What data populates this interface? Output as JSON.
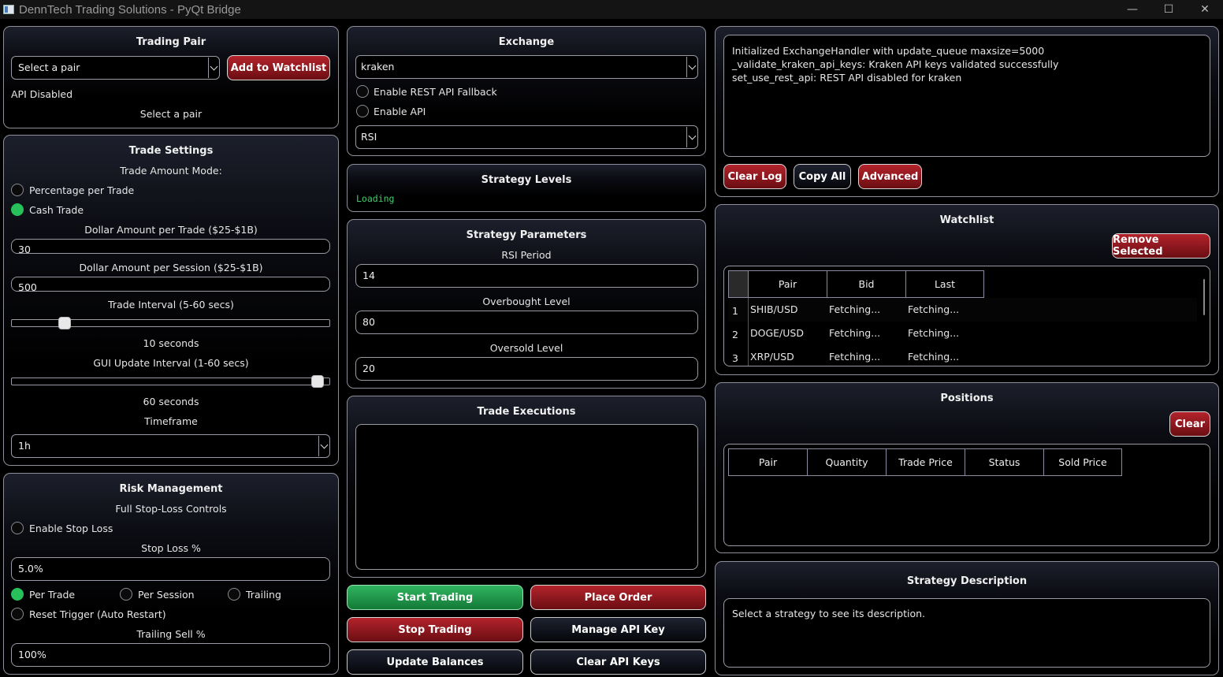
{
  "window": {
    "title": "DennTech Trading Solutions - PyQt Bridge",
    "minimize": "—",
    "maximize": "☐",
    "close": "✕"
  },
  "trading_pair": {
    "title": "Trading Pair",
    "select_value": "Select a pair",
    "add_button": "Add to Watchlist",
    "api_status": "API Disabled",
    "selected_label": "Select a pair"
  },
  "trade_settings": {
    "title": "Trade Settings",
    "mode_label": "Trade Amount Mode:",
    "mode_percentage": "Percentage per Trade",
    "mode_cash": "Cash Trade",
    "mode_selected": "Cash Trade",
    "dollar_trade_label": "Dollar Amount per Trade ($25-$1B)",
    "dollar_trade_value": "30",
    "dollar_session_label": "Dollar Amount per Session ($25-$1B)",
    "dollar_session_value": "500",
    "interval_label": "Trade Interval (5-60 secs)",
    "interval_value": 10,
    "interval_min": 5,
    "interval_max": 60,
    "interval_text": "10 seconds",
    "gui_label": "GUI Update Interval (1-60 secs)",
    "gui_value": 60,
    "gui_min": 1,
    "gui_max": 60,
    "gui_text": "60 seconds",
    "timeframe_label": "Timeframe",
    "timeframe_value": "1h"
  },
  "risk": {
    "title": "Risk Management",
    "subtitle": "Full Stop-Loss Controls",
    "enable_stop_loss": "Enable Stop Loss",
    "stop_loss_label": "Stop Loss %",
    "stop_loss_value": "5.0%",
    "per_trade": "Per Trade",
    "per_session": "Per Session",
    "trailing": "Trailing",
    "scope_selected": "Per Trade",
    "reset_trigger": "Reset Trigger (Auto Restart)",
    "trailing_sell_label": "Trailing Sell %",
    "trailing_sell_value": "100%"
  },
  "exchange": {
    "title": "Exchange",
    "select_value": "kraken",
    "rest_fallback": "Enable REST API Fallback",
    "enable_api": "Enable API",
    "strategy_value": "RSI"
  },
  "strategy_levels": {
    "title": "Strategy Levels",
    "status": "Loading"
  },
  "strategy_params": {
    "title": "Strategy Parameters",
    "rsi_label": "RSI Period",
    "rsi_value": "14",
    "overbought_label": "Overbought Level",
    "overbought_value": "80",
    "oversold_label": "Oversold Level",
    "oversold_value": "20"
  },
  "executions": {
    "title": "Trade Executions"
  },
  "actions": {
    "start": "Start Trading",
    "place_order": "Place Order",
    "stop": "Stop Trading",
    "manage_api": "Manage API Key",
    "update_balances": "Update Balances",
    "clear_api": "Clear API Keys"
  },
  "log": {
    "lines": [
      "Initialized ExchangeHandler with update_queue maxsize=5000",
      "_validate_kraken_api_keys: Kraken API keys validated successfully",
      "set_use_rest_api: REST API disabled for kraken"
    ],
    "clear": "Clear Log",
    "copy": "Copy All",
    "advanced": "Advanced"
  },
  "watchlist": {
    "title": "Watchlist",
    "remove": "Remove Selected",
    "headers": [
      "Pair",
      "Bid",
      "Last"
    ],
    "rows": [
      {
        "n": "1",
        "pair": "SHIB/USD",
        "bid": "Fetching...",
        "last": "Fetching..."
      },
      {
        "n": "2",
        "pair": "DOGE/USD",
        "bid": "Fetching...",
        "last": "Fetching..."
      },
      {
        "n": "3",
        "pair": "XRP/USD",
        "bid": "Fetching...",
        "last": "Fetching..."
      }
    ]
  },
  "positions": {
    "title": "Positions",
    "clear": "Clear",
    "headers": [
      "Pair",
      "Quantity",
      "Trade Price",
      "Status",
      "Sold Price"
    ]
  },
  "description": {
    "title": "Strategy Description",
    "text": "Select a strategy to see its description."
  },
  "colors": {
    "accent_red": "#b3232b",
    "accent_green": "#30b45f",
    "radio_on": "#27c05a",
    "loading_text": "#3ecf6a"
  }
}
